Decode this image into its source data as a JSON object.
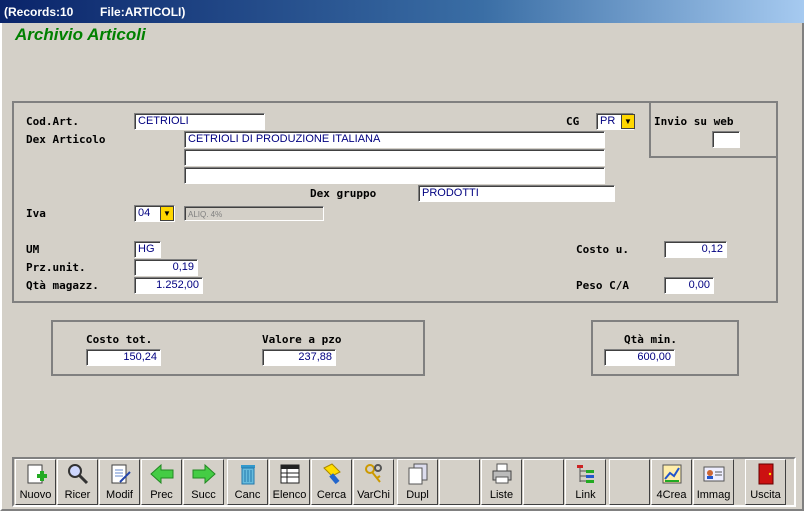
{
  "window": {
    "title": "(Records:10        File:ARTICOLI)"
  },
  "app": {
    "title": "Archivio Articoli"
  },
  "form": {
    "cod_art_label": "Cod.Art.",
    "cod_art_value": "CETRIOLI",
    "cg_label": "CG",
    "cg_value": "PR",
    "invio_web_label": "Invio su web",
    "invio_web_value": "",
    "dex_articolo_label": "Dex Articolo",
    "dex_articolo_line1": "CETRIOLI DI PRODUZIONE ITALIANA",
    "dex_articolo_line2": "",
    "dex_articolo_line3": "",
    "dex_gruppo_label": "Dex gruppo",
    "dex_gruppo_value": "PRODOTTI",
    "iva_label": "Iva",
    "iva_value": "04",
    "iva_desc": "ALIQ. 4%",
    "um_label": "UM",
    "um_value": "HG",
    "prz_unit_label": "Prz.unit.",
    "prz_unit_value": "0,19",
    "qta_magazz_label": "Qtà magazz.",
    "qta_magazz_value": "1.252,00",
    "costo_u_label": "Costo u.",
    "costo_u_value": "0,12",
    "peso_label": "Peso C/A",
    "peso_value": "0,00"
  },
  "totals": {
    "costo_tot_label": "Costo tot.",
    "costo_tot_value": "150,24",
    "valore_pzo_label": "Valore a pzo",
    "valore_pzo_value": "237,88",
    "qta_min_label": "Qtà min.",
    "qta_min_value": "600,00"
  },
  "toolbar": {
    "buttons": [
      "Nuovo",
      "Ricer",
      "Modif",
      "Prec",
      "Succ",
      "Canc",
      "Elenco",
      "Cerca",
      "VarChi",
      "Dupl",
      "",
      "Liste",
      "",
      "Link",
      "",
      "4Crea",
      "Immag",
      "Uscita"
    ]
  },
  "colors": {
    "title_green": "#008000",
    "value_blue": "#000080",
    "combo_yellow": "#ffd700"
  }
}
